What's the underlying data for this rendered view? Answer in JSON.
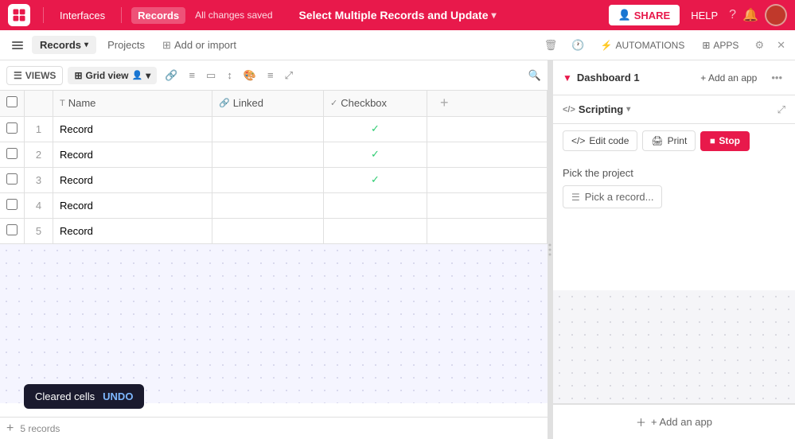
{
  "topNav": {
    "interfaces_label": "Interfaces",
    "saved_label": "All changes saved",
    "title": "Select Multiple Records and Update",
    "share_label": "SHARE",
    "help_label": "HELP",
    "records_label": "Records"
  },
  "secondNav": {
    "records_tab": "Records",
    "projects_tab": "Projects",
    "add_import_label": "Add or import",
    "automations_label": "AUTOMATIONS",
    "apps_label": "APPS"
  },
  "toolbar": {
    "views_label": "VIEWS",
    "grid_view_label": "Grid view"
  },
  "table": {
    "columns": [
      {
        "label": "Name",
        "type": "text",
        "icon": "T"
      },
      {
        "label": "Linked",
        "type": "link",
        "icon": "🔗"
      },
      {
        "label": "Checkbox",
        "type": "check",
        "icon": "✓"
      }
    ],
    "rows": [
      {
        "num": 1,
        "name": "Record",
        "linked": "",
        "checked": true
      },
      {
        "num": 2,
        "name": "Record",
        "linked": "",
        "checked": true
      },
      {
        "num": 3,
        "name": "Record",
        "linked": "",
        "checked": true
      },
      {
        "num": 4,
        "name": "Record",
        "linked": "",
        "checked": false
      },
      {
        "num": 5,
        "name": "Record",
        "linked": "",
        "checked": false
      }
    ],
    "add_row_label": "+",
    "record_count": "5 records"
  },
  "toast": {
    "message": "Cleared cells",
    "undo_label": "UNDO"
  },
  "rightPanel": {
    "dashboard_title": "Dashboard 1",
    "add_app_label": "+ Add an app",
    "script_title": "Scripting",
    "edit_code_label": "Edit code",
    "print_label": "Print",
    "stop_label": "Stop",
    "pick_project_label": "Pick the project",
    "pick_record_label": "Pick a record...",
    "add_app_bottom_label": "+ Add an app"
  }
}
